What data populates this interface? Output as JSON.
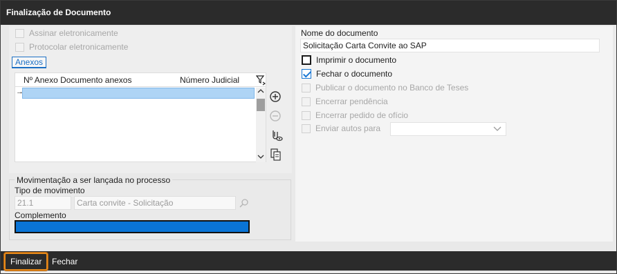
{
  "window": {
    "title": "Finalização de Documento"
  },
  "left": {
    "checkboxes": [
      {
        "label": "Assinar eletronicamente",
        "checked": false,
        "enabled": false
      },
      {
        "label": "Protocolar eletronicamente",
        "checked": false,
        "enabled": false
      }
    ],
    "tab": {
      "label": "Anexos"
    },
    "grid": {
      "columns": [
        "Nº Anexo Documento anexos",
        "Número Judicial"
      ],
      "row_indicator": "→",
      "rows": [
        {
          "values": [
            "",
            ""
          ]
        }
      ]
    },
    "side_icons": [
      "add-icon",
      "remove-icon",
      "attach-view-icon",
      "copy-attachments-icon"
    ]
  },
  "movement": {
    "legend": "Movimentação a ser lançada no processo",
    "tipo_label": "Tipo de movimento",
    "tipo_code": "21.1",
    "tipo_desc": "Carta convite - Solicitação",
    "complemento_label": "Complemento",
    "complemento_value": ""
  },
  "right": {
    "nome_label": "Nome do documento",
    "nome_value": "Solicitação Carta Convite ao SAP",
    "options": [
      {
        "label": "Imprimir o documento",
        "checked": false,
        "enabled": true
      },
      {
        "label": "Fechar o documento",
        "checked": true,
        "enabled": true
      },
      {
        "label": "Publicar o documento no Banco de Teses",
        "checked": false,
        "enabled": false
      },
      {
        "label": "Encerrar pendência",
        "checked": false,
        "enabled": false
      },
      {
        "label": "Encerrar pedido de ofício",
        "checked": false,
        "enabled": false
      },
      {
        "label": "Enviar autos para",
        "checked": false,
        "enabled": false
      }
    ],
    "enviar_select_value": ""
  },
  "buttons": {
    "finalizar": "Finalizar",
    "fechar": "Fechar"
  },
  "colors": {
    "accent": "#1877d4",
    "focus_outline": "#e88a1a",
    "titlebar": "#2b2b2b",
    "selection": "#0a74d6"
  }
}
